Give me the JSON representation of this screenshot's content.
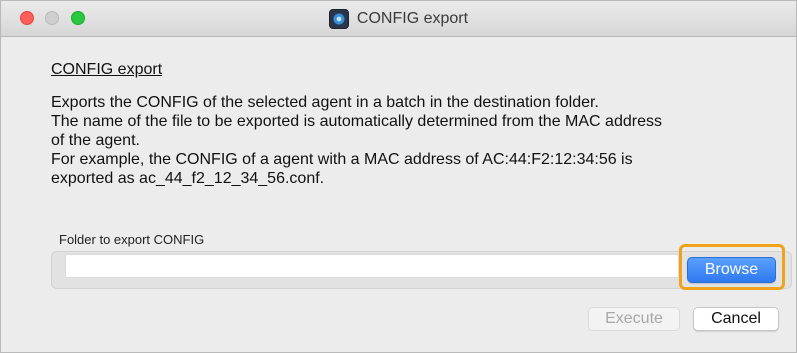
{
  "window": {
    "title": "CONFIG export",
    "app_icon": "app-icon"
  },
  "content": {
    "heading": "CONFIG export",
    "description_lines": [
      "Exports the CONFIG of the selected agent in a batch in the destination folder.",
      "The name of the file to be exported is automatically determined from the MAC address",
      "of the agent.",
      "For example, the CONFIG of a agent with a MAC address of AC:44:F2:12:34:56 is",
      "exported as ac_44_f2_12_34_56.conf."
    ]
  },
  "folder": {
    "label": "Folder to export CONFIG",
    "value": "",
    "browse_label": "Browse"
  },
  "actions": {
    "execute_label": "Execute",
    "execute_enabled": false,
    "cancel_label": "Cancel"
  },
  "colors": {
    "highlight": "#f0a21b",
    "primary_button": "#2f79f0",
    "close": "#fe5f58",
    "maximize": "#28c840"
  }
}
